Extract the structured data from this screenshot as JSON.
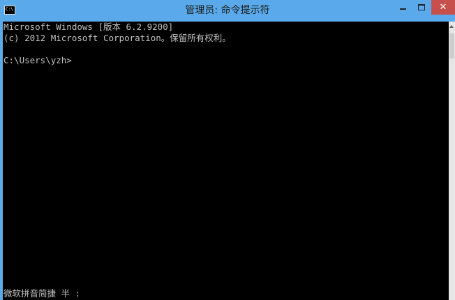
{
  "window": {
    "title": "管理员: 命令提示符",
    "icon_label": "C:\\",
    "close_symbol": "✕",
    "titlebar_color": "#5aa9ea",
    "close_color": "#c7504c"
  },
  "console": {
    "lines": [
      "Microsoft Windows [版本 6.2.9200]",
      "(c) 2012 Microsoft Corporation。保留所有权利。",
      "",
      "C:\\Users\\yzh>"
    ],
    "text_color": "#c0c0c0",
    "background": "#000000"
  },
  "ime": {
    "status": "微软拼音简捷 半 :"
  },
  "icons": {
    "app": "cmd-app-icon",
    "minimize": "minimize-icon",
    "maximize": "maximize-icon",
    "close": "close-icon",
    "scroll_up": "scroll-up-arrow-icon"
  }
}
